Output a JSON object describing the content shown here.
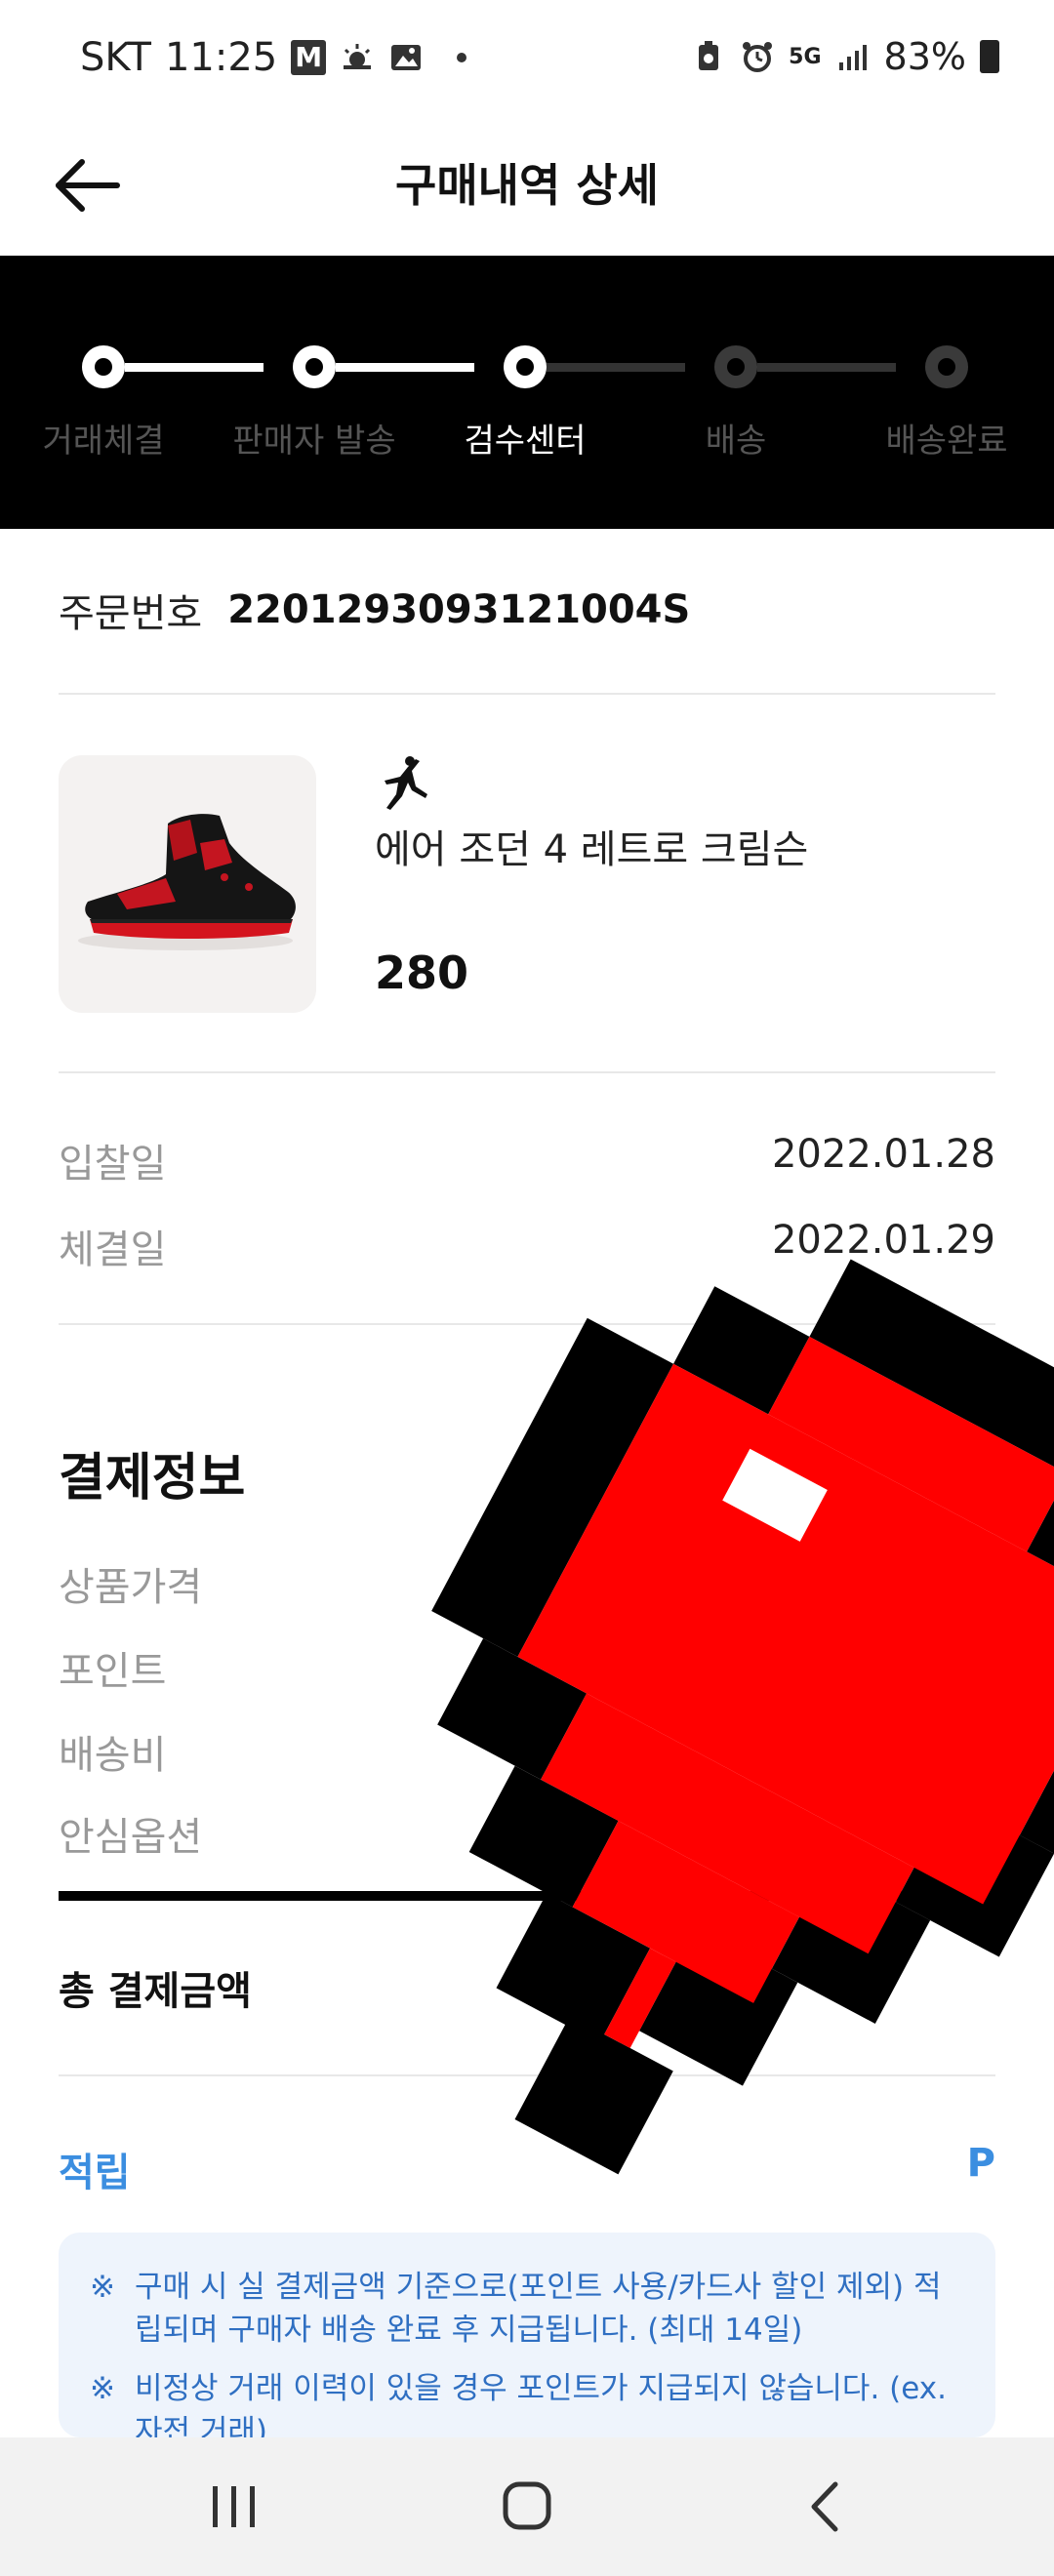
{
  "status_bar": {
    "carrier": "SKT",
    "time": "11:25",
    "mail_letter": "M",
    "network": "5G",
    "battery": "83%"
  },
  "header": {
    "title": "구매내역 상세"
  },
  "progress": {
    "steps": [
      {
        "label": "거래체결",
        "state": "done"
      },
      {
        "label": "판매자 발송",
        "state": "done"
      },
      {
        "label": "검수센터",
        "state": "current"
      },
      {
        "label": "배송",
        "state": "todo"
      },
      {
        "label": "배송완료",
        "state": "todo"
      }
    ]
  },
  "order": {
    "label": "주문번호",
    "number": "2201293093121004S"
  },
  "product": {
    "brand_icon": "jordan-jumpman-icon",
    "name": "에어 조던 4 레트로 크림슨",
    "size": "280"
  },
  "dates": {
    "bid_label": "입찰일",
    "bid_date": "2022.01.28",
    "deal_label": "체결일",
    "deal_date": "2022.01.29"
  },
  "payment": {
    "title": "결제정보",
    "rows": [
      "상품가격",
      "포인트",
      "배송비",
      "안심옵션"
    ],
    "total_label": "총 결제금액",
    "earn_label": "적립",
    "earn_value_visible": "P"
  },
  "notice": {
    "items": [
      "구매 시 실 결제금액 기준으로(포인트 사용/카드사 할인 제외) 적립되며 구매자 배송 완료 후 지급됩니다. (최대 14일)",
      "비정상 거래 이력이 있을 경우 포인트가 지급되지 않습니다. (ex. 자전 거래)"
    ]
  },
  "colors": {
    "accent_blue": "#3b8ee0",
    "progress_bg": "#000000",
    "overlay_red": "#ff0000"
  },
  "navbar": {
    "icons": [
      "recent-apps-icon",
      "home-icon",
      "back-icon"
    ]
  }
}
